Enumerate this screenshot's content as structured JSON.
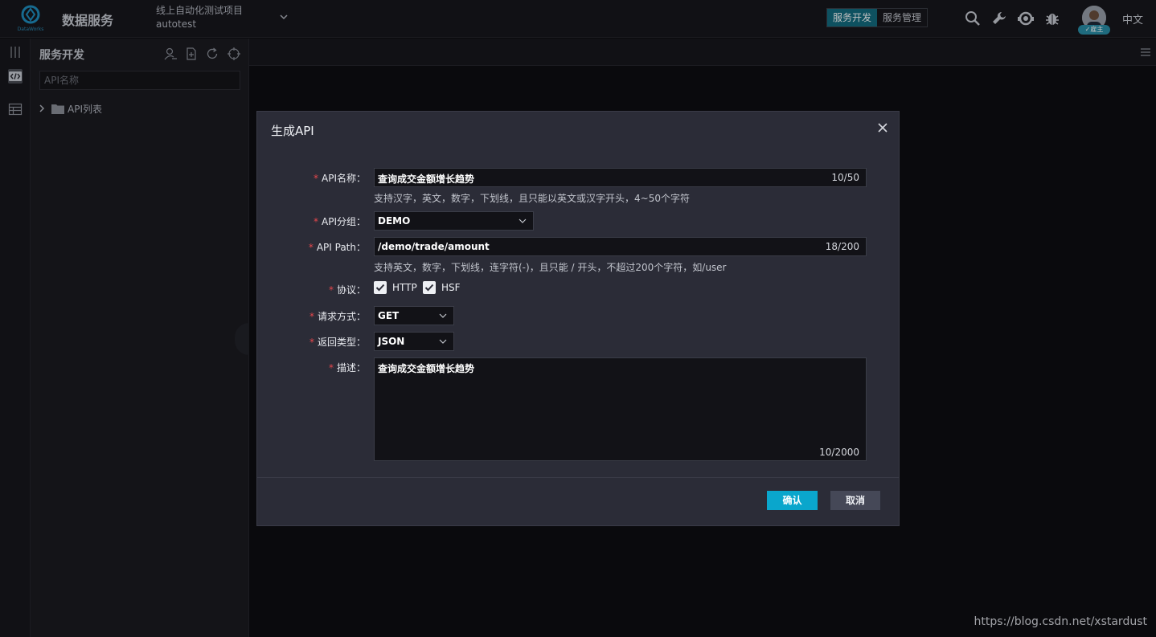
{
  "topbar": {
    "logo_text": "DataWorks",
    "app_title": "数据服务",
    "project_name": "线上自动化测试项目",
    "project_code": "autotest",
    "mode_tabs": [
      "服务开发",
      "服务管理"
    ],
    "active_mode": "服务开发",
    "user_badge": "雇主",
    "language": "中文",
    "icons": [
      "search-icon",
      "wrench-icon",
      "support-icon",
      "bug-icon"
    ]
  },
  "panel": {
    "title": "服务开发",
    "search_placeholder": "API名称",
    "tree": [
      {
        "label": "API列表",
        "expanded": false
      }
    ]
  },
  "modal": {
    "title": "生成API",
    "fields": {
      "api_name": {
        "label": "API名称：",
        "value": "查询成交金额增长趋势",
        "count": "10/50",
        "hint": "支持汉字，英文，数字，下划线，且只能以英文或汉字开头，4~50个字符"
      },
      "api_group": {
        "label": "API分组：",
        "value": "DEMO"
      },
      "api_path": {
        "label": "API Path：",
        "value": "/demo/trade/amount",
        "count": "18/200",
        "hint": "支持英文，数字，下划线，连字符(-)，且只能 / 开头，不超过200个字符，如/user"
      },
      "protocol": {
        "label": "协议：",
        "options": [
          {
            "label": "HTTP",
            "checked": true
          },
          {
            "label": "HSF",
            "checked": true
          }
        ]
      },
      "request_method": {
        "label": "请求方式：",
        "value": "GET"
      },
      "return_type": {
        "label": "返回类型：",
        "value": "JSON"
      },
      "description": {
        "label": "描述：",
        "value": "查询成交金额增长趋势",
        "count": "10/2000"
      }
    },
    "confirm_label": "确认",
    "cancel_label": "取消"
  },
  "watermark": "https://blog.csdn.net/xstardust",
  "colors": {
    "accent": "#0aa6cc",
    "active_tab": "#136c80",
    "required": "#e5484d"
  }
}
